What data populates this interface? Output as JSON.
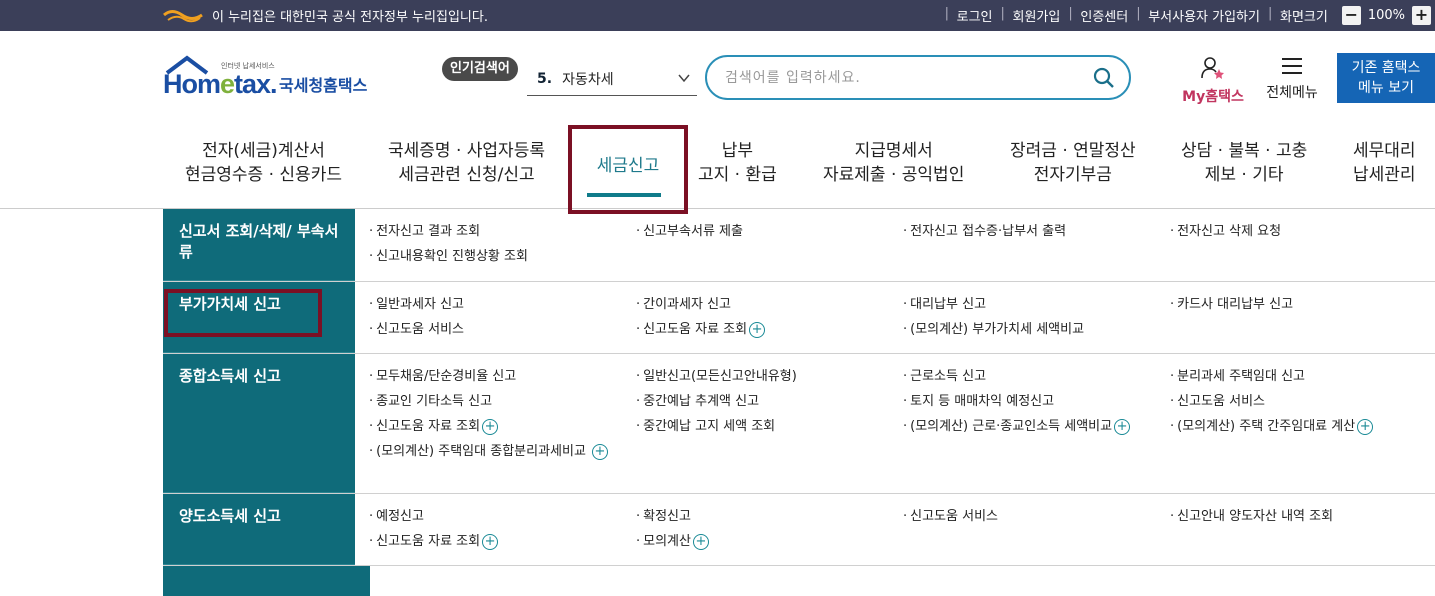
{
  "gov_banner": {
    "text": "이 누리집은 대한민국 공식 전자정부 누리집입니다.",
    "links": [
      "로그인",
      "회원가입",
      "인증센터",
      "부서사용자 가입하기",
      "화면크기"
    ],
    "zoom_minus": "−",
    "zoom_value": "100%",
    "zoom_plus": "+"
  },
  "logo": {
    "small_text": "인터넷 납세서비스",
    "main_ho": "Hom",
    "main_e": "e",
    "main_tax": "tax.",
    "kr_text": "국세청홈택스"
  },
  "popular": {
    "badge": "인기검색어",
    "rank": "5.",
    "keyword": "자동차세"
  },
  "search": {
    "placeholder": "검색어를 입력하세요."
  },
  "header_buttons": {
    "my_hometax": "My홈택스",
    "all_menu": "전체메뉴",
    "old_home_line1": "기존 홈택스",
    "old_home_line2": "메뉴 보기"
  },
  "main_nav": [
    {
      "line1": "전자(세금)계산서",
      "line2": "현금영수증 · 신용카드"
    },
    {
      "line1": "국세증명 · 사업자등록",
      "line2": "세금관련 신청/신고"
    },
    {
      "line1": "세금신고",
      "line2": ""
    },
    {
      "line1": "납부",
      "line2": "고지 · 환급"
    },
    {
      "line1": "지급명세서",
      "line2": "자료제출 · 공익법인"
    },
    {
      "line1": "장려금 · 연말정산",
      "line2": "전자기부금"
    },
    {
      "line1": "상담 · 불복 · 고충",
      "line2": "제보 · 기타"
    },
    {
      "line1": "세무대리",
      "line2": "납세관리"
    }
  ],
  "submenu": [
    {
      "head": "신고서 조회/삭제/ 부속서류",
      "links": [
        {
          "text": "전자신고 결과 조회",
          "plus": false
        },
        {
          "text": "신고부속서류 제출",
          "plus": false
        },
        {
          "text": "전자신고 접수증·납부서 출력",
          "plus": false
        },
        {
          "text": "전자신고 삭제 요청",
          "plus": false
        },
        {
          "text": "신고내용확인 진행상황 조회",
          "plus": false
        }
      ]
    },
    {
      "head": "부가가치세 신고",
      "links": [
        {
          "text": "일반과세자 신고",
          "plus": false
        },
        {
          "text": "간이과세자 신고",
          "plus": false
        },
        {
          "text": "대리납부 신고",
          "plus": false
        },
        {
          "text": "카드사 대리납부 신고",
          "plus": false
        },
        {
          "text": "신고도움 서비스",
          "plus": false
        },
        {
          "text": "신고도움 자료 조회",
          "plus": true
        },
        {
          "text": "(모의계산) 부가가치세 세액비교",
          "plus": false
        }
      ]
    },
    {
      "head": "종합소득세 신고",
      "links": [
        {
          "text": "모두채움/단순경비율 신고",
          "plus": false
        },
        {
          "text": "일반신고(모든신고안내유형)",
          "plus": false
        },
        {
          "text": "근로소득 신고",
          "plus": false
        },
        {
          "text": "분리과세 주택임대 신고",
          "plus": false
        },
        {
          "text": "종교인 기타소득 신고",
          "plus": false
        },
        {
          "text": "중간예납 추계액 신고",
          "plus": false
        },
        {
          "text": "토지 등 매매차익 예정신고",
          "plus": false
        },
        {
          "text": "신고도움 서비스",
          "plus": false
        },
        {
          "text": "신고도움 자료 조회",
          "plus": true
        },
        {
          "text": "중간예납 고지 세액 조회",
          "plus": false
        },
        {
          "text": "(모의계산) 근로·종교인소득 세액비교",
          "plus": true
        },
        {
          "text": "(모의계산) 주택 간주임대료 계산",
          "plus": true
        },
        {
          "text": "(모의계산) 주택임대 종합분리과세비교",
          "plus": true
        }
      ]
    },
    {
      "head": "양도소득세 신고",
      "links": [
        {
          "text": "예정신고",
          "plus": false
        },
        {
          "text": "확정신고",
          "plus": false
        },
        {
          "text": "신고도움 서비스",
          "plus": false
        },
        {
          "text": "신고안내 양도자산 내역 조회",
          "plus": false
        },
        {
          "text": "신고도움 자료 조회",
          "plus": true
        },
        {
          "text": "모의계산",
          "plus": true
        }
      ]
    }
  ],
  "colors": {
    "teal": "#0f6b7a",
    "highlight": "#7b1024",
    "brand_blue": "#1565b5"
  }
}
